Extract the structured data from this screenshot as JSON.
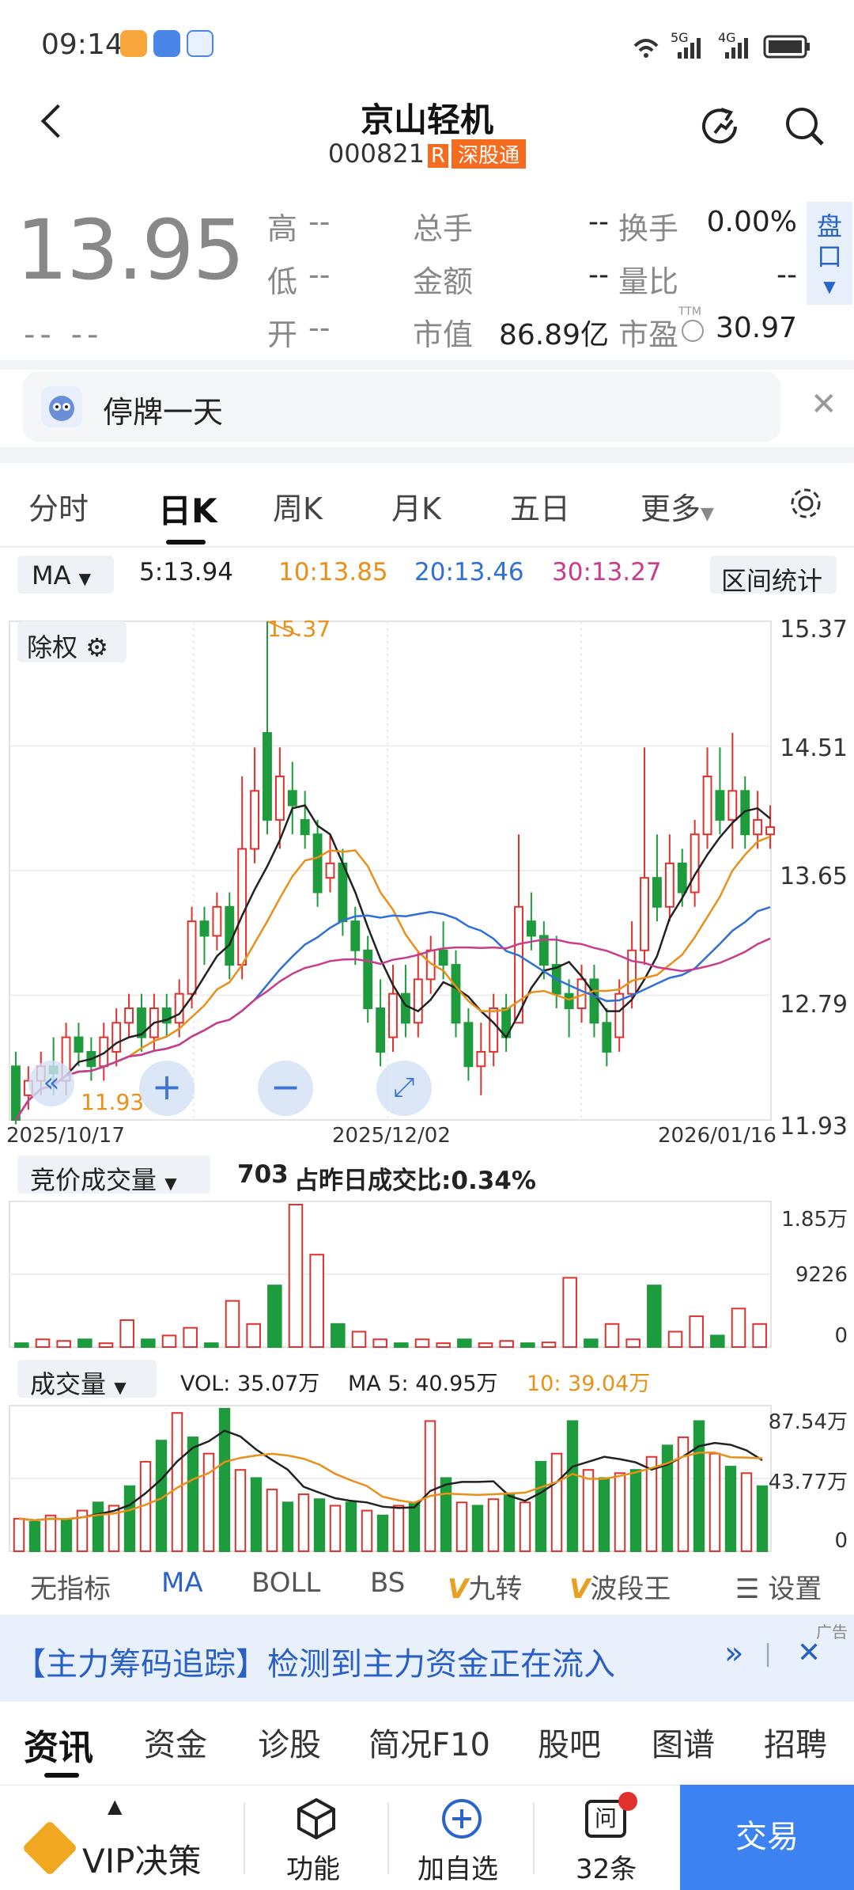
{
  "status_bar": {
    "time": "09:14",
    "network_5g": "5G",
    "network_4g": "4G"
  },
  "header": {
    "title": "京山轻机",
    "code": "000821",
    "badge_r": "R",
    "badge_connect": "深股通"
  },
  "quote": {
    "price": "13.95",
    "change": "-- --",
    "high_label": "高",
    "high": "--",
    "low_label": "低",
    "low": "--",
    "open_label": "开",
    "open": "--",
    "volume_label": "总手",
    "volume": "--",
    "amount_label": "金额",
    "amount": "--",
    "mcap_label": "市值",
    "mcap": "86.89亿",
    "turnover_label": "换手",
    "turnover": "0.00%",
    "vr_label": "量比",
    "vr": "--",
    "pe_label": "市盈",
    "pe_sup": "TTM",
    "pe": "30.97",
    "pankou": "盘口"
  },
  "notice": {
    "text": "停牌一天"
  },
  "tabs": [
    "分时",
    "日K",
    "周K",
    "月K",
    "五日",
    "更多"
  ],
  "ma": {
    "selector": "MA",
    "ma5": "5:13.94",
    "ma10": "10:13.85",
    "ma20": "20:13.46",
    "ma30": "30:13.27",
    "range_btn": "区间统计"
  },
  "kchart": {
    "adjust": "除权",
    "y_labels": [
      "15.37",
      "14.51",
      "13.65",
      "12.79",
      "11.93"
    ],
    "dates": [
      "2025/10/17",
      "2025/12/02",
      "2026/01/16"
    ],
    "max_label": "15.37",
    "min_label": "11.93"
  },
  "auction": {
    "selector": "竞价成交量",
    "value": "703",
    "ratio": "占昨日成交比:0.34%",
    "y_labels": [
      "1.85万",
      "9226",
      "0"
    ]
  },
  "vol": {
    "selector": "成交量",
    "vol": "VOL: 35.07万",
    "ma5": "MA 5: 40.95万",
    "ma10": "10: 39.04万",
    "y_labels": [
      "87.54万",
      "43.77万",
      "0"
    ]
  },
  "indicators": [
    "无指标",
    "MA",
    "BOLL",
    "BS",
    "九转",
    "波段王"
  ],
  "indicator_settings": "设置",
  "ad": {
    "text": "【主力筹码追踪】检测到主力资金正在流入",
    "tag": "广告"
  },
  "news_tabs": [
    "资讯",
    "资金",
    "诊股",
    "简况F10",
    "股吧",
    "图谱",
    "招聘"
  ],
  "bottom": {
    "vip": "VIP决策",
    "func": "功能",
    "add": "加自选",
    "ask_label": "问",
    "ask_count": "32条",
    "trade": "交易"
  },
  "colors": {
    "up": "#e0312d",
    "down": "#1e9b3c",
    "ma5": "#222222",
    "ma10": "#e8901a",
    "ma20": "#2f6fd6",
    "ma30": "#c83c8c",
    "accent": "#2a63c9"
  },
  "chart_data": [
    {
      "type": "candlestick",
      "ylim": [
        11.93,
        15.37
      ],
      "ma": {
        "ma5": 13.94,
        "ma10": 13.85,
        "ma20": 13.46,
        "ma30": 13.27
      },
      "candles": [
        [
          12.3,
          11.93,
          12.4,
          11.9
        ],
        [
          12.1,
          12.2,
          12.3,
          12.0
        ],
        [
          12.2,
          12.3,
          12.4,
          12.1
        ],
        [
          12.3,
          12.25,
          12.5,
          12.1
        ],
        [
          12.2,
          12.5,
          12.6,
          12.1
        ],
        [
          12.5,
          12.4,
          12.6,
          12.3
        ],
        [
          12.4,
          12.3,
          12.5,
          12.2
        ],
        [
          12.3,
          12.5,
          12.6,
          12.2
        ],
        [
          12.4,
          12.6,
          12.7,
          12.3
        ],
        [
          12.6,
          12.7,
          12.8,
          12.5
        ],
        [
          12.7,
          12.5,
          12.8,
          12.4
        ],
        [
          12.5,
          12.7,
          12.8,
          12.4
        ],
        [
          12.7,
          12.6,
          12.8,
          12.5
        ],
        [
          12.6,
          12.8,
          12.9,
          12.5
        ],
        [
          12.8,
          13.3,
          13.4,
          12.7
        ],
        [
          13.3,
          13.2,
          13.4,
          13.0
        ],
        [
          13.2,
          13.4,
          13.5,
          13.1
        ],
        [
          13.4,
          13.0,
          13.5,
          12.9
        ],
        [
          13.0,
          13.8,
          14.3,
          12.9
        ],
        [
          13.8,
          14.2,
          14.5,
          13.7
        ],
        [
          14.6,
          14.0,
          15.37,
          13.9
        ],
        [
          14.0,
          14.3,
          14.5,
          13.8
        ],
        [
          14.2,
          14.1,
          14.4,
          13.9
        ],
        [
          14.0,
          13.9,
          14.2,
          13.8
        ],
        [
          13.9,
          13.5,
          14.0,
          13.4
        ],
        [
          13.6,
          13.7,
          13.9,
          13.5
        ],
        [
          13.7,
          13.3,
          13.8,
          13.2
        ],
        [
          13.3,
          13.1,
          13.4,
          13.0
        ],
        [
          13.1,
          12.7,
          13.2,
          12.6
        ],
        [
          12.7,
          12.4,
          12.9,
          12.3
        ],
        [
          12.5,
          12.8,
          13.0,
          12.4
        ],
        [
          12.8,
          12.6,
          13.0,
          12.5
        ],
        [
          12.6,
          12.9,
          13.1,
          12.5
        ],
        [
          12.9,
          13.1,
          13.2,
          12.8
        ],
        [
          13.1,
          13.0,
          13.3,
          12.9
        ],
        [
          13.0,
          12.6,
          13.1,
          12.5
        ],
        [
          12.6,
          12.3,
          12.7,
          12.2
        ],
        [
          12.3,
          12.4,
          12.6,
          12.1
        ],
        [
          12.4,
          12.7,
          12.8,
          12.3
        ],
        [
          12.7,
          12.5,
          12.8,
          12.4
        ],
        [
          12.6,
          13.4,
          13.9,
          12.6
        ],
        [
          13.3,
          13.2,
          13.5,
          13.1
        ],
        [
          13.2,
          13.0,
          13.3,
          12.9
        ],
        [
          13.0,
          12.8,
          13.2,
          12.7
        ],
        [
          12.8,
          12.7,
          12.9,
          12.5
        ],
        [
          12.7,
          12.9,
          13.0,
          12.6
        ],
        [
          12.9,
          12.6,
          13.0,
          12.5
        ],
        [
          12.6,
          12.4,
          12.7,
          12.3
        ],
        [
          12.5,
          12.8,
          12.9,
          12.4
        ],
        [
          12.8,
          13.1,
          13.3,
          12.7
        ],
        [
          13.1,
          13.6,
          14.5,
          13.0
        ],
        [
          13.6,
          13.4,
          13.9,
          13.3
        ],
        [
          13.4,
          13.7,
          13.9,
          13.3
        ],
        [
          13.7,
          13.5,
          13.8,
          13.4
        ],
        [
          13.5,
          13.9,
          14.0,
          13.4
        ],
        [
          13.9,
          14.3,
          14.5,
          13.8
        ],
        [
          14.2,
          14.0,
          14.5,
          13.9
        ],
        [
          14.0,
          14.2,
          14.6,
          13.8
        ],
        [
          14.2,
          13.9,
          14.3,
          13.8
        ],
        [
          13.9,
          14.0,
          14.2,
          13.8
        ],
        [
          13.9,
          13.95,
          14.1,
          13.8
        ]
      ]
    },
    {
      "type": "bar",
      "name": "竞价成交量",
      "values": [
        0.05,
        0.1,
        0.08,
        0.1,
        0.05,
        0.35,
        0.1,
        0.15,
        0.25,
        0.05,
        0.6,
        0.3,
        0.8,
        1.85,
        1.2,
        0.3,
        0.2,
        0.1,
        0.05,
        0.1,
        0.05,
        0.1,
        0.05,
        0.08,
        0.05,
        0.06,
        0.9,
        0.1,
        0.3,
        0.1,
        0.8,
        0.2,
        0.4,
        0.15,
        0.5,
        0.3
      ]
    },
    {
      "type": "bar",
      "name": "成交量",
      "ylim": [
        0,
        87.54
      ],
      "values": [
        20,
        18,
        22,
        19,
        25,
        30,
        28,
        40,
        55,
        68,
        85,
        70,
        60,
        87.54,
        50,
        45,
        38,
        30,
        35,
        32,
        28,
        30,
        25,
        22,
        28,
        30,
        80,
        45,
        30,
        28,
        32,
        35,
        30,
        55,
        60,
        80,
        50,
        45,
        48,
        50,
        58,
        65,
        70,
        80,
        60,
        52,
        48,
        40
      ]
    }
  ]
}
